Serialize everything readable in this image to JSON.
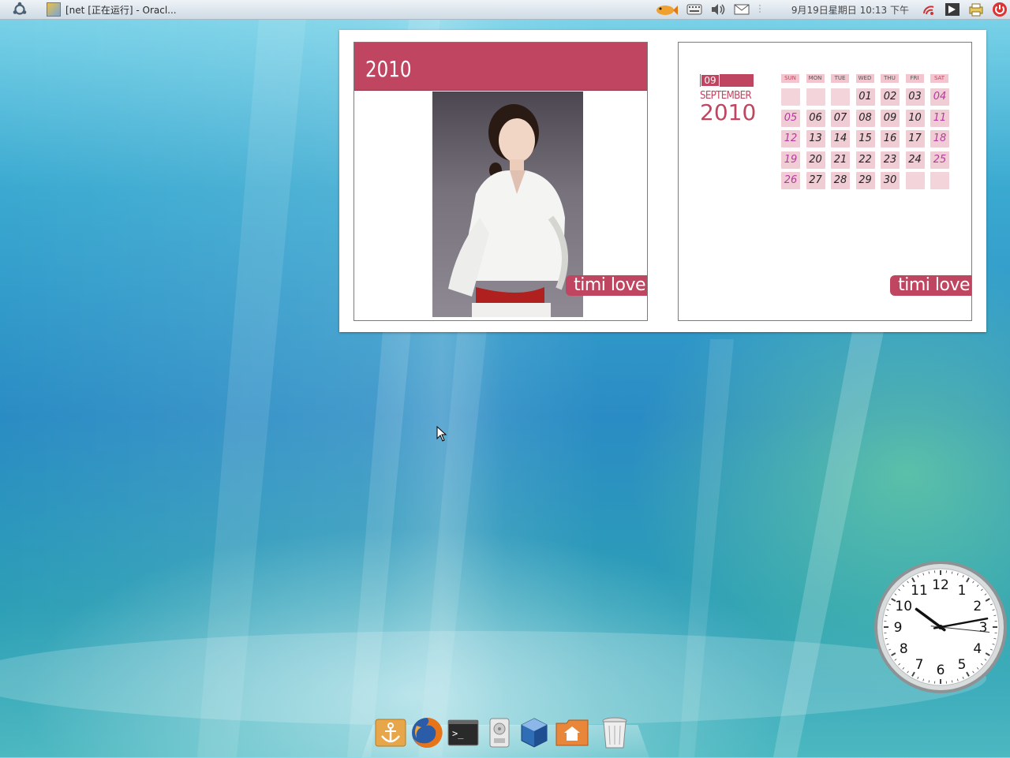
{
  "top_panel": {
    "window_title": "[net [正在运行] - Oracl...",
    "datetime": "9月19日星期日 10:13 下午"
  },
  "calendar_widget": {
    "year_label": "2010",
    "tag_text": "timi love",
    "month_number": "09",
    "month_name": "SEPTEMBER",
    "month_year": "2010",
    "weekdays": [
      "SUN",
      "MON",
      "TUE",
      "WED",
      "THU",
      "FRI",
      "SAT"
    ],
    "weeks": [
      [
        "",
        "",
        "",
        "01",
        "02",
        "03",
        "04"
      ],
      [
        "05",
        "06",
        "07",
        "08",
        "09",
        "10",
        "11"
      ],
      [
        "12",
        "13",
        "14",
        "15",
        "16",
        "17",
        "18"
      ],
      [
        "19",
        "20",
        "21",
        "22",
        "23",
        "24",
        "25"
      ],
      [
        "26",
        "27",
        "28",
        "29",
        "30",
        "",
        ""
      ]
    ]
  },
  "analog_clock": {
    "hour": 10,
    "minute": 13,
    "second": 16,
    "numerals": [
      "12",
      "1",
      "2",
      "3",
      "4",
      "5",
      "6",
      "7",
      "8",
      "9",
      "10",
      "11"
    ]
  },
  "dock": {
    "items": [
      "anchor-icon",
      "firefox-icon",
      "terminal-icon",
      "disk-icon",
      "virtualbox-icon",
      "home-folder-icon",
      "trash-icon"
    ]
  },
  "colors": {
    "accent": "#c04560",
    "weekend_text": "#b43a9e"
  }
}
